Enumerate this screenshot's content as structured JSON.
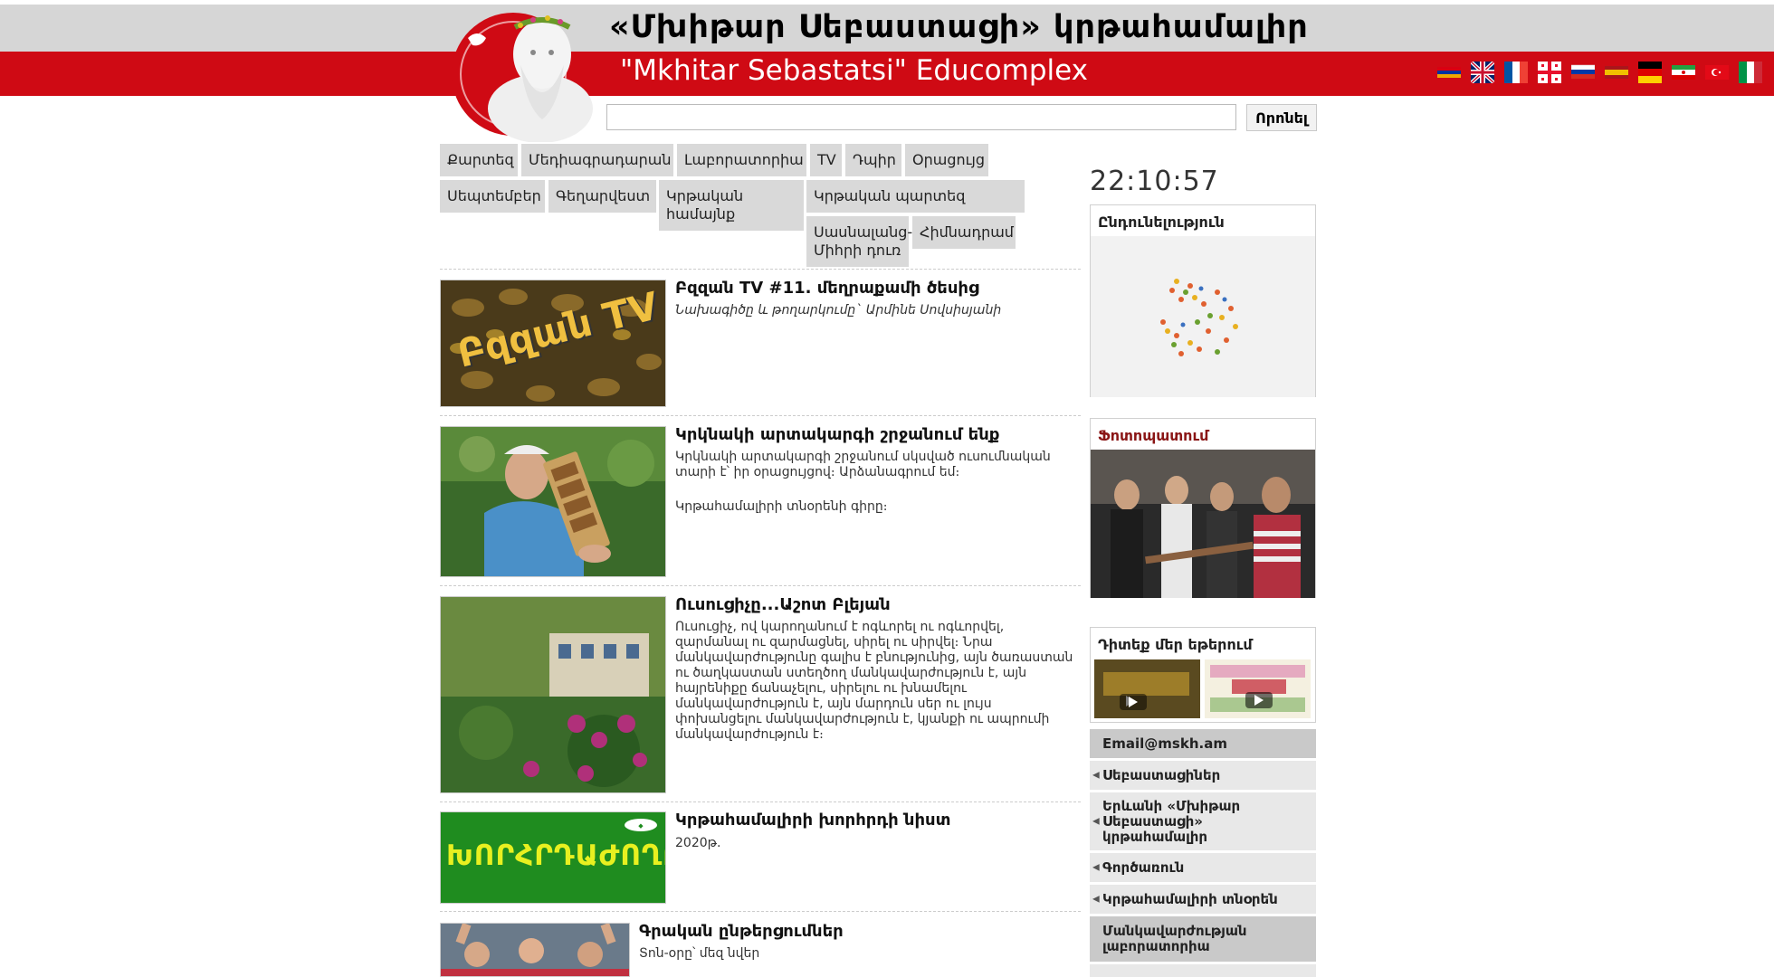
{
  "header": {
    "title_hy": "«Մխիթար Սեբաստացի» կրթահամալիր",
    "title_en": "\"Mkhitar Sebastatsi\" Educomplex"
  },
  "languages": [
    "Հայերեն",
    "English",
    "Français",
    "ქართული",
    "Русский",
    "Español",
    "Deutsch",
    "فارسی",
    "Türkçe",
    "Italiano"
  ],
  "search": {
    "value": "",
    "placeholder": "",
    "button_label": "Որոնել"
  },
  "nav": {
    "map": "Քարտեզ",
    "mediacenter": "Մեդիագրադարան",
    "laboratories": "Լաբորատորիա",
    "tv": "TV",
    "blog": "Դպիր",
    "calendar": "Օրացույց",
    "seminars": "Սեպտեմբեր",
    "art": "Գեղարվեստ",
    "community": "Կրթական համայնք",
    "edu_garden": "Կրթական պարտեզ",
    "student_house": "Սասնալանց-Միհրի դուռ",
    "foundation": "Հիմնադրամ"
  },
  "clock": "22:10:57",
  "sidebar": {
    "reading_title": "Ընդունելություն",
    "photo_title": "Ֆոտոպատում",
    "watch_title": "Դիտեք մեր եթերում",
    "email": "Email@mskh.am",
    "menu": [
      "Սեբաստացիներ",
      "Երևանի «Մխիթար Սեբաստացի» կրթահամալիր",
      "Գործառուն",
      "Կրթահամալիրի տնօրեն",
      "Մանկավարժության լաբորատորիա"
    ]
  },
  "articles": [
    {
      "title": "Բզզան TV #11. մեղրաքամի ծեսից",
      "text": "Նախագիծը և թողարկումը` Արմինե Սովսիսյանի",
      "thumb_label": "Բզզան TV"
    },
    {
      "title": "Կրկնակի արտակարգի շրջանում ենք",
      "text": "Կրկնակի արտակարգի շրջանում սկսված ուսումնական տարի է՝ իր օրացույցով։ Արձանագրում եմ։",
      "text2": "Կրթահամալիրի տնօրենի գիրը։"
    },
    {
      "title": "Ուսուցիչը...Աշոտ Բլեյան",
      "text": "Ուսուցիչ, ով կարողանում է ոգևորել ու ոգևորվել, զարմանալ ու զարմացնել, սիրել ու սիրվել։ Նրա մանկավարժությունը գալիս է բնությունից, այն ծառաստան ու ծաղկաստան ստեղծող մանկավարժություն է, այն հայրենիքը ճանաչելու, սիրելու ու խնամելու մանկավարժություն է, այն մարդուն սեր ու լույս փոխանցելու մանկավարժություն է, կյանքի ու ապրումի մանկավարժություն է։"
    },
    {
      "title": "Կրթահամալիրի խորհրդի նիստ",
      "text": "2020թ.",
      "thumb_label": "ԽՈՐՀՐԴԱԺՈՂՈՎ"
    },
    {
      "title": "Գրական ընթերցումներ",
      "text": "Տոն-օրը՝ մեզ նվեր"
    }
  ],
  "colors": {
    "brand_red": "#cf0a14",
    "header_gray": "#d6d6d6",
    "nav_gray": "#d9d9d9"
  }
}
